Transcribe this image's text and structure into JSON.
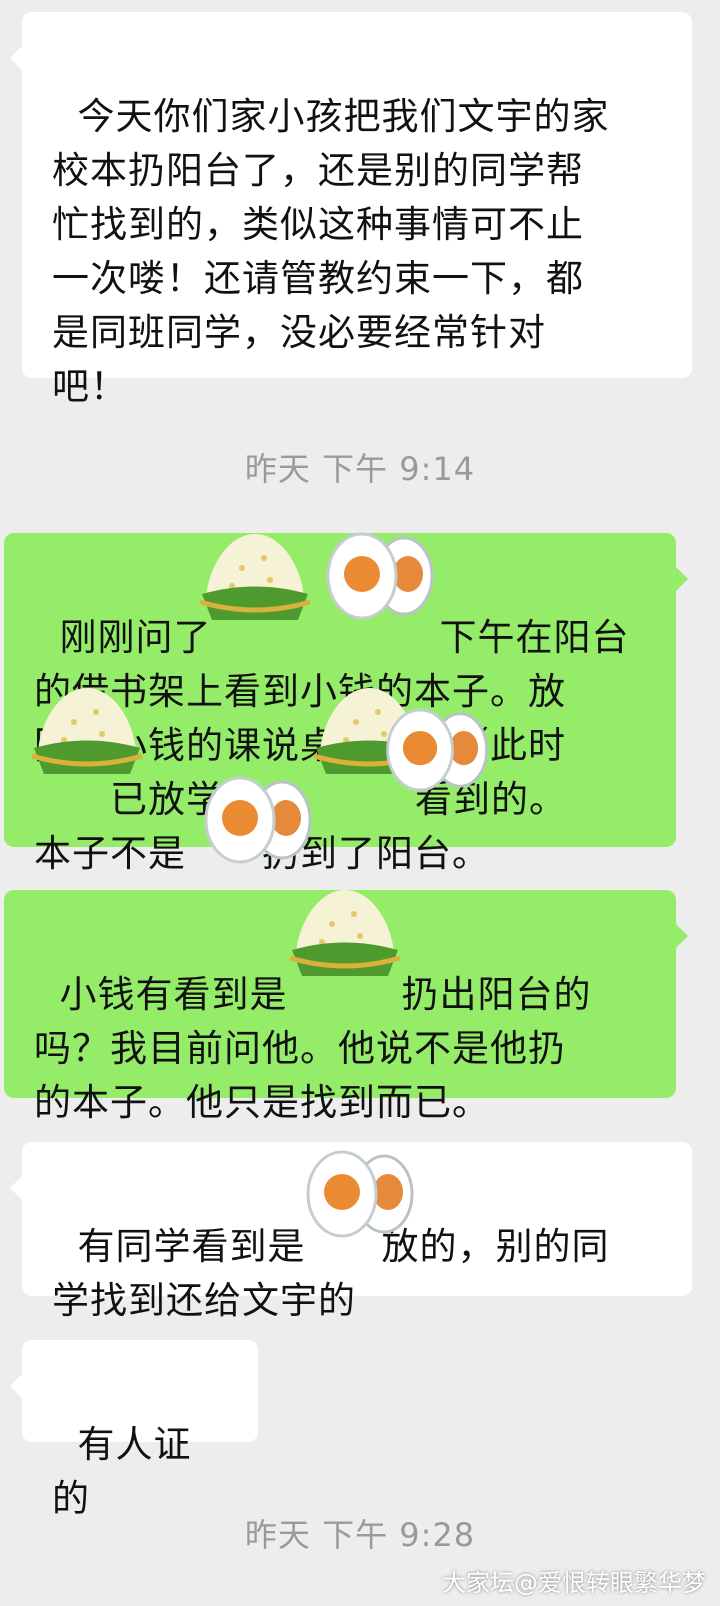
{
  "messages": [
    {
      "side": "incoming",
      "text": "今天你们家小孩把我们文宇的家\n校本扔阳台了，还是别的同学帮\n忙找到的，类似这种事情可不止\n一次喽！还请管教约束一下，都\n是同班同学，没必要经常针对\n吧！"
    },
    {
      "side": "outgoing",
      "text": "刚刚问了　　　　　　下午在阳台\n的借书架上看到小钱的本子。放\n回了小钱的课说桌洞里了（此时\n　　已放学），　　　　看到的。\n本子不是　　扔到了阳台。"
    },
    {
      "side": "outgoing",
      "text": "小钱有看到是　　　扔出阳台的\n吗？我目前问他。他说不是他扔\n的本子。他只是找到而已。"
    },
    {
      "side": "incoming",
      "text": "有同学看到是　　放的，别的同\n学找到还给文宇的"
    },
    {
      "side": "incoming",
      "text": "有人证的"
    }
  ],
  "timestamps": [
    "昨天 下午 9:14",
    "昨天 下午 9:28"
  ],
  "stickers": [
    "rice-dumpling-icon",
    "salted-egg-icon"
  ],
  "watermark": "大家坛@爱恨转眼繁华梦",
  "colors": {
    "background": "#ededed",
    "incoming": "#ffffff",
    "outgoing": "#95ec69",
    "timestamp": "#9a9a9a"
  }
}
